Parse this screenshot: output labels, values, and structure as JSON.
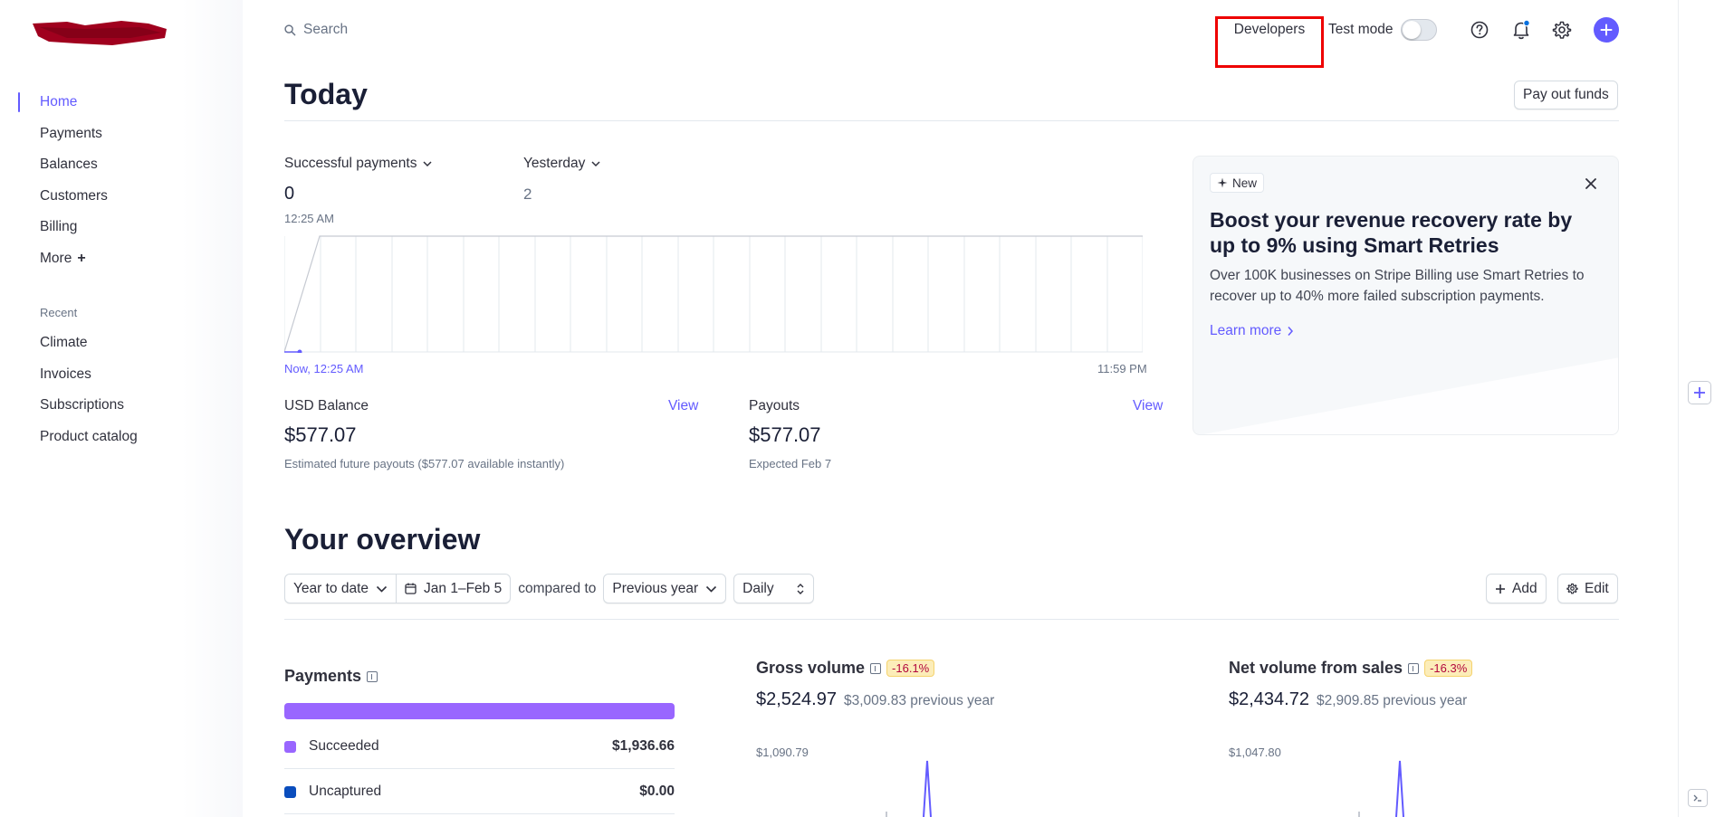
{
  "colors": {
    "accent": "#635bff",
    "highlight_box": "#ee0000",
    "payments_bar": "#9966ff",
    "succeeded_dot": "#9966ff",
    "uncaptured_dot": "#0a4dbd",
    "delta_text": "#b3063d",
    "delta_bg": "#fcedb9"
  },
  "sidebar": {
    "nav": [
      {
        "label": "Home",
        "active": true
      },
      {
        "label": "Payments"
      },
      {
        "label": "Balances"
      },
      {
        "label": "Customers"
      },
      {
        "label": "Billing"
      },
      {
        "label": "More"
      }
    ],
    "more_icon": "+",
    "recent_title": "Recent",
    "recent": [
      {
        "label": "Climate"
      },
      {
        "label": "Invoices"
      },
      {
        "label": "Subscriptions"
      },
      {
        "label": "Product catalog"
      }
    ]
  },
  "topbar": {
    "search_placeholder": "Search",
    "developers_label": "Developers",
    "test_mode_label": "Test mode",
    "test_mode_on": false,
    "icons": [
      "help-icon",
      "notification-bell-icon",
      "gear-icon",
      "plus-icon"
    ]
  },
  "today": {
    "title": "Today",
    "payout_button": "Pay out funds",
    "metric_label": "Successful payments",
    "metric_value": "0",
    "compare_label": "Yesterday",
    "compare_value": "2",
    "current_time": "12:25 AM",
    "start_label": "Now, 12:25 AM",
    "end_label": "11:59 PM",
    "balance": {
      "title": "USD Balance",
      "link": "View",
      "amount": "$577.07",
      "note": "Estimated future payouts ($577.07 available instantly)"
    },
    "payouts": {
      "title": "Payouts",
      "link": "View",
      "amount": "$577.07",
      "note": "Expected Feb 7"
    }
  },
  "promo": {
    "badge": "New",
    "title": "Boost your revenue recovery rate by up to 9% using Smart Retries",
    "body": "Over 100K businesses on Stripe Billing use Smart Retries to recover up to 40% more failed subscription payments.",
    "link": "Learn more"
  },
  "overview": {
    "title": "Your overview",
    "range": "Year to date",
    "dates": "Jan 1–Feb 5",
    "compared_to": "compared to",
    "comparison": "Previous year",
    "interval": "Daily",
    "add_button": "Add",
    "edit_button": "Edit",
    "payments": {
      "title": "Payments",
      "rows": [
        {
          "label": "Succeeded",
          "amount": "$1,936.66"
        },
        {
          "label": "Uncaptured",
          "amount": "$0.00"
        }
      ]
    },
    "gross": {
      "title": "Gross volume",
      "delta": "-16.1%",
      "value": "$2,524.97",
      "previous": "$3,009.83 previous year",
      "axis_max": "$1,090.79"
    },
    "net": {
      "title": "Net volume from sales",
      "delta": "-16.3%",
      "value": "$2,434.72",
      "previous": "$2,909.85 previous year",
      "axis_max": "$1,047.80"
    }
  }
}
